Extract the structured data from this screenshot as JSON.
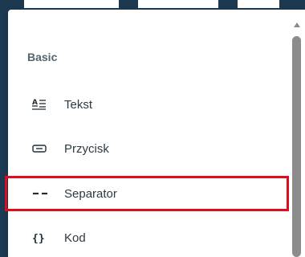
{
  "menu": {
    "section_title": "Basic",
    "items": [
      {
        "label": "Tekst",
        "icon": "text-format-icon"
      },
      {
        "label": "Przycisk",
        "icon": "button-icon"
      },
      {
        "label": "Separator",
        "icon": "separator-icon"
      },
      {
        "label": "Kod",
        "icon": "code-braces-icon"
      }
    ]
  },
  "highlight_color": "#e00b1c",
  "backdrop_color": "#1b3a52"
}
